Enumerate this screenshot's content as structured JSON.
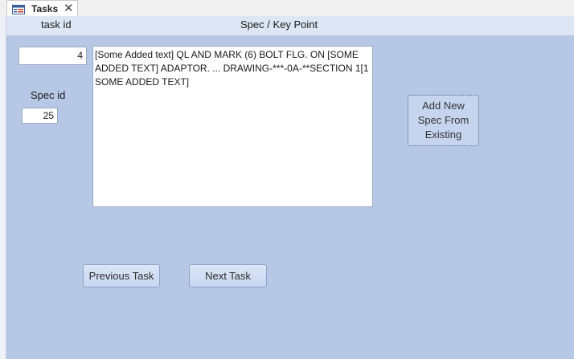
{
  "tab": {
    "title": "Tasks",
    "close_glyph": "✕",
    "icon": "form-icon"
  },
  "header": {
    "task_id_label": "task id",
    "spec_key_point_label": "Spec / Key Point"
  },
  "task_id": {
    "value": "4"
  },
  "spec_id": {
    "label": "Spec id",
    "value": "25"
  },
  "spec_text": {
    "value": "[Some Added text] QL AND MARK (6) BOLT FLG. ON [SOME ADDED TEXT] ADAPTOR. ... DRAWING-***-0A-**SECTION 1[1 SOME ADDED TEXT]"
  },
  "buttons": {
    "add_new_spec_line1": "Add New",
    "add_new_spec_line2": "Spec From",
    "add_new_spec_line3": "Existing",
    "previous_task": "Previous Task",
    "next_task": "Next Task"
  }
}
